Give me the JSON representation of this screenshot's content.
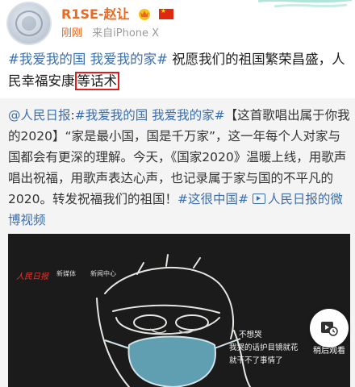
{
  "header": {
    "username": "R1SE-赵让",
    "time": "刚刚",
    "source": "来自iPhone X"
  },
  "post": {
    "topic": "#我爱我的国 我爱我的家#",
    "text_before": " 祝愿我们的祖国繁荣昌盛，人民幸福安康",
    "highlighted": "等话术"
  },
  "repost": {
    "mention": "@人民日报",
    "colon": ":",
    "topic": "#我爱我的国 我爱我的家#",
    "body": "【这首歌唱出属于你我的2020】“家是最小国，国是千万家”，这一年每个人对家与国都会有更深的理解。今天，《国家2020》温暖上线，用歌声唱出祝福，用歌声表达心声，也记录属于家与国的不平凡的2020。转发祝福我们的祖国！",
    "topic2": "#这很中国#",
    "video_link": "人民日报的微博视频"
  },
  "video": {
    "logo_main": "人民日报",
    "logo_media": "新媒体",
    "logo_center": "新闻中心",
    "subtitle_line1": "不想哭",
    "subtitle_line2": "我哭的话护目镜就花",
    "subtitle_line3": "就干不了事情了",
    "watch_later": "稍后观看"
  },
  "colors": {
    "username": "#e8681f",
    "topic": "#3c6fb0",
    "highlight_box": "#e31b1b",
    "repost_bg": "#f4f4f4"
  }
}
